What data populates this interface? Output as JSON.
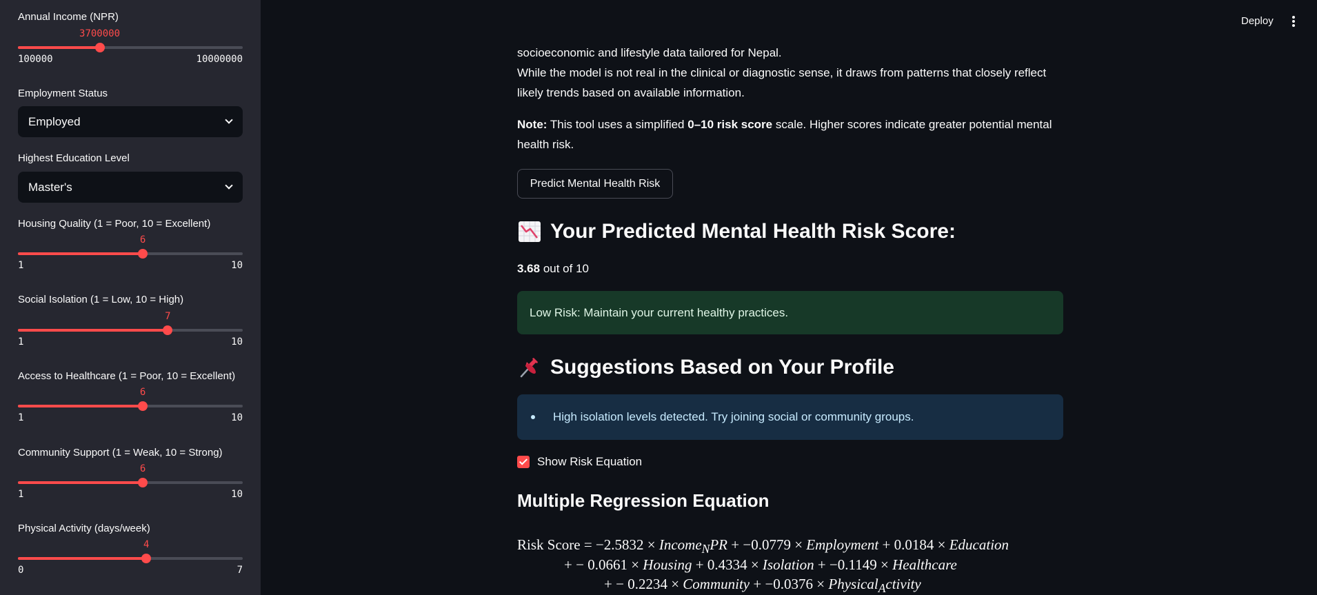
{
  "sidebar": {
    "income": {
      "label": "Annual Income (NPR)",
      "value": "3700000",
      "min": "100000",
      "max": "10000000",
      "fraction": 0.3636
    },
    "employment": {
      "label": "Employment Status",
      "selected": "Employed"
    },
    "education": {
      "label": "Highest Education Level",
      "selected": "Master's"
    },
    "housing": {
      "label": "Housing Quality (1 = Poor, 10 = Excellent)",
      "value": "6",
      "min": "1",
      "max": "10",
      "fraction": 0.5556
    },
    "isolation": {
      "label": "Social Isolation (1 = Low, 10 = High)",
      "value": "7",
      "min": "1",
      "max": "10",
      "fraction": 0.6667
    },
    "healthcare": {
      "label": "Access to Healthcare (1 = Poor, 10 = Excellent)",
      "value": "6",
      "min": "1",
      "max": "10",
      "fraction": 0.5556
    },
    "community": {
      "label": "Community Support (1 = Weak, 10 = Strong)",
      "value": "6",
      "min": "1",
      "max": "10",
      "fraction": 0.5556
    },
    "activity": {
      "label": "Physical Activity (days/week)",
      "value": "4",
      "min": "0",
      "max": "7",
      "fraction": 0.5714
    }
  },
  "header": {
    "deploy_label": "Deploy",
    "menu_icon": "kebab-menu-icon"
  },
  "main": {
    "intro_line1": "socioeconomic and lifestyle data tailored for Nepal.",
    "intro_line2": "While the model is not real in the clinical or diagnostic sense, it draws from patterns that closely reflect",
    "intro_line3": "likely trends based on available information.",
    "note_label": "Note:",
    "note_text_a": " This tool uses a simplified ",
    "note_bold": "0–10 risk score",
    "note_text_b": " scale. Higher scores indicate greater potential mental",
    "note_line2": "health risk.",
    "predict_button": "Predict Mental Health Risk",
    "score_heading": "Your Predicted Mental Health Risk Score:",
    "score_value": "3.68",
    "score_suffix": " out of 10",
    "risk_message": "Low Risk: Maintain your current healthy practices.",
    "suggestions_heading": "Suggestions Based on Your Profile",
    "suggestion_item": "High isolation levels detected. Try joining social or community groups.",
    "show_equation_label": "Show Risk Equation",
    "show_equation_checked": true,
    "equation_heading": "Multiple Regression Equation",
    "equation": {
      "lhs": "Risk Score",
      "c_income": "−2.5832",
      "c_employment": "−0.0779",
      "c_education": "0.0184",
      "c_housing": "0.0661",
      "c_isolation": "0.4334",
      "c_healthcare": "−0.1149",
      "c_community": "0.2234",
      "c_activity": "−0.0376"
    }
  },
  "colors": {
    "accent": "#ff4b4b",
    "success_bg": "#173928",
    "info_bg": "#172d43",
    "sidebar_bg": "#262730",
    "app_bg": "#0e1117"
  }
}
